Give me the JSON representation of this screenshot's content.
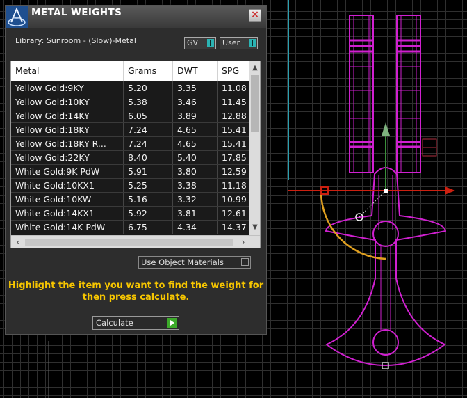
{
  "dialog": {
    "title": "METAL WEIGHTS",
    "close_label": "×",
    "library_label": "Library: Sunroom - (Slow)-Metal",
    "gv_toggle": "GV",
    "user_toggle": "User",
    "use_object_materials": "Use Object Materials",
    "hint": "Highlight the item you want to find the weight for then press calculate.",
    "calculate_label": "Calculate"
  },
  "table": {
    "columns": [
      "Metal",
      "Grams",
      "DWT",
      "SPG"
    ],
    "rows": [
      [
        "Yellow Gold:9KY",
        "5.20",
        "3.35",
        "11.08"
      ],
      [
        "Yellow Gold:10KY",
        "5.38",
        "3.46",
        "11.45"
      ],
      [
        "Yellow Gold:14KY",
        "6.05",
        "3.89",
        "12.88"
      ],
      [
        "Yellow Gold:18KY",
        "7.24",
        "4.65",
        "15.41"
      ],
      [
        "Yellow Gold:18KY R...",
        "7.24",
        "4.65",
        "15.41"
      ],
      [
        "Yellow Gold:22KY",
        "8.40",
        "5.40",
        "17.85"
      ],
      [
        "White Gold:9K PdW",
        "5.91",
        "3.80",
        "12.59"
      ],
      [
        "White Gold:10KX1",
        "5.25",
        "3.38",
        "11.18"
      ],
      [
        "White Gold:10KW",
        "5.16",
        "3.32",
        "10.99"
      ],
      [
        "White Gold:14KX1",
        "5.92",
        "3.81",
        "12.61"
      ],
      [
        "White Gold:14K PdW",
        "6.75",
        "4.34",
        "14.37"
      ]
    ]
  },
  "colors": {
    "accent_text": "#f7c600",
    "toggle": "#2bb3b3",
    "calculate_arrow": "#3caa2a",
    "shape": "#d020d0",
    "axis_x": "#cc2010",
    "axis_y": "#3a8f3a",
    "rotate_arc": "#e0a020",
    "guide": "#2aa0b0"
  }
}
